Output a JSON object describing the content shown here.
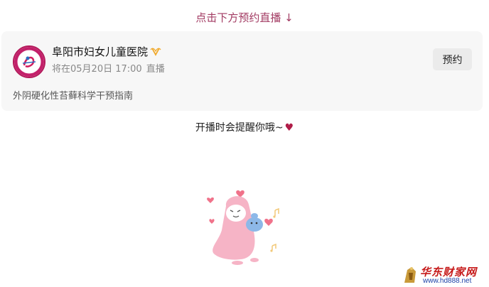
{
  "header": {
    "hint": "点击下方预约直播 ↓"
  },
  "card": {
    "account_name": "阜阳市妇女儿童医院",
    "verified_icon": "verified-badge-icon",
    "schedule_prefix": "将在05月20日 17:00",
    "schedule_suffix": "直播",
    "reserve_label": "预约",
    "live_title": "外阴硬化性苔藓科学干预指南"
  },
  "reminder": {
    "text": "开播时会提醒你哦~",
    "heart": "♥"
  },
  "watermark": {
    "name": "华东财家网",
    "url": "www.hd888.net"
  },
  "colors": {
    "accent": "#a23a62",
    "heart": "#b01d48",
    "logo_ring": "#b3195a"
  }
}
